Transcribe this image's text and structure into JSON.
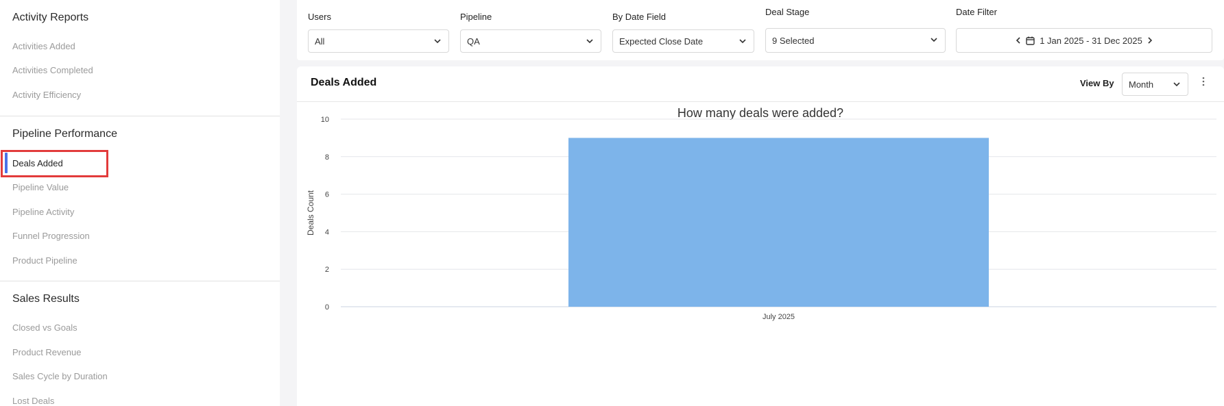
{
  "sidebar": {
    "sections": [
      {
        "title": "Activity Reports",
        "items": [
          "Activities Added",
          "Activities Completed",
          "Activity Efficiency"
        ]
      },
      {
        "title": "Pipeline Performance",
        "items": [
          "Deals Added",
          "Pipeline Value",
          "Pipeline Activity",
          "Funnel Progression",
          "Product Pipeline"
        ]
      },
      {
        "title": "Sales Results",
        "items": [
          "Closed vs Goals",
          "Product Revenue",
          "Sales Cycle by Duration",
          "Lost Deals"
        ]
      }
    ],
    "active_item": "Deals Added"
  },
  "filters": {
    "users": {
      "label": "Users",
      "value": "All"
    },
    "pipeline": {
      "label": "Pipeline",
      "value": "QA"
    },
    "date_field": {
      "label": "By Date Field",
      "value": "Expected Close Date"
    },
    "deal_stage": {
      "label": "Deal Stage",
      "value": "9 Selected"
    },
    "date_filter": {
      "label": "Date Filter",
      "value": "1 Jan 2025 - 31 Dec 2025"
    }
  },
  "report": {
    "title": "Deals Added",
    "view_by_label": "View By",
    "view_by_value": "Month"
  },
  "colors": {
    "bar": "#7db4ea",
    "accent": "#4a72e8",
    "highlight": "#e23b3b"
  },
  "chart_data": {
    "type": "bar",
    "title": "How many deals were added?",
    "categories": [
      "July 2025"
    ],
    "values": [
      9
    ],
    "ylabel": "Deals Count",
    "xlabel": "",
    "ylim": [
      0,
      10
    ],
    "yticks": [
      0,
      2,
      4,
      6,
      8,
      10
    ],
    "grid": true
  }
}
